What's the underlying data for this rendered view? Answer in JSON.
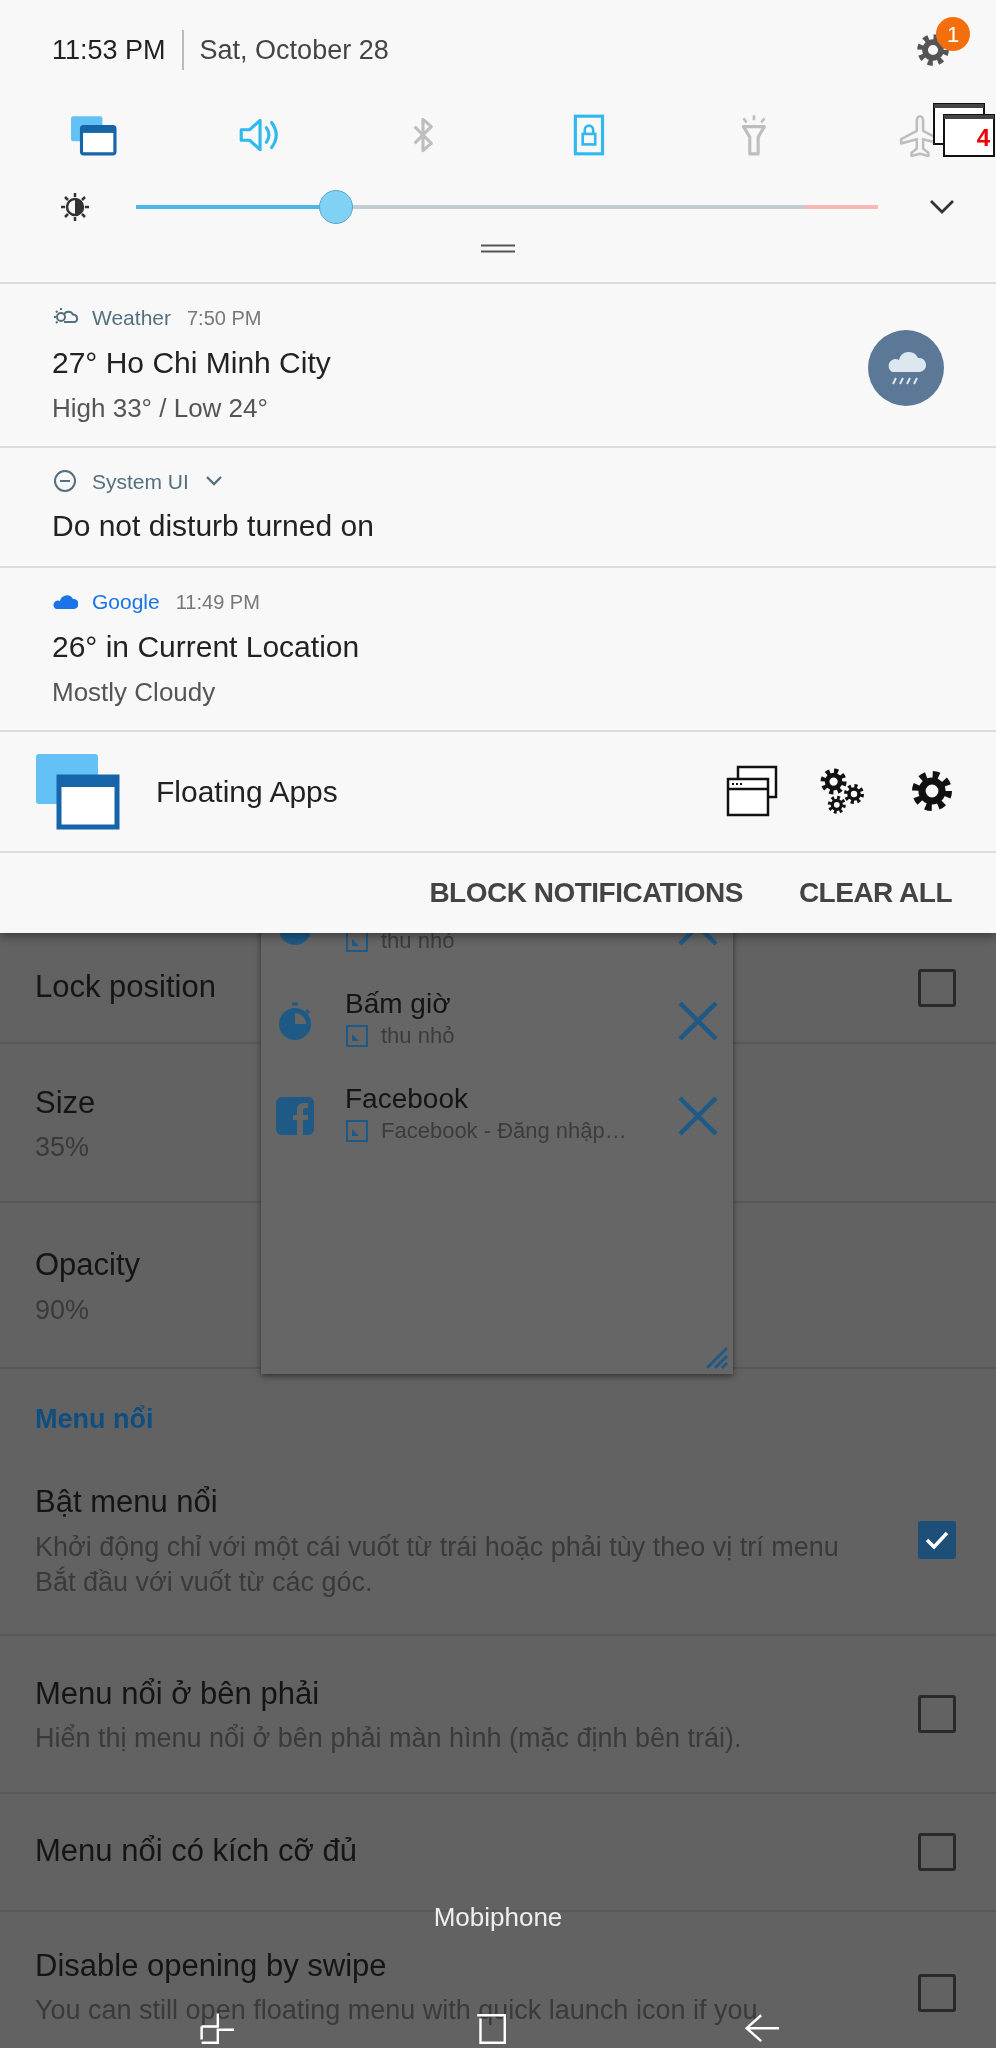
{
  "status_header": {
    "time": "11:53 PM",
    "date": "Sat, October 28",
    "settings_badge": "1"
  },
  "quick_tiles": [
    {
      "kind": "windows",
      "on": true
    },
    {
      "kind": "sound",
      "on": true
    },
    {
      "kind": "bluetooth",
      "on": false
    },
    {
      "kind": "lock",
      "on": true
    },
    {
      "kind": "flashlight",
      "on": false
    },
    {
      "kind": "airplane",
      "on": false
    }
  ],
  "floating_bubble": {
    "count": "4"
  },
  "brightness": {
    "level": 0.27
  },
  "notifications": [
    {
      "kind": "weather",
      "app": "Weather",
      "color": "#54707f",
      "time": "7:50 PM",
      "title": "27° Ho Chi Minh City",
      "text": "High 33° / Low 24°"
    },
    {
      "kind": "dnd",
      "app": "System UI",
      "color": "#54707f",
      "title": "Do not disturb turned on"
    },
    {
      "kind": "cloud",
      "app": "Google",
      "color": "#1a73e8",
      "time": "11:49 PM",
      "title": "26° in Current Location",
      "text": "Mostly Cloudy"
    }
  ],
  "persistent": {
    "title": "Floating Apps"
  },
  "actions": [
    "BLOCK NOTIFICATIONS",
    "CLEAR ALL"
  ],
  "settings": [
    {
      "kind": "toggle",
      "title": "Lock position",
      "checked": false
    },
    {
      "kind": "value",
      "title": "Size",
      "value": "35%"
    },
    {
      "kind": "value",
      "title": "Opacity",
      "value": "90%"
    },
    {
      "kind": "header",
      "title": "Menu nổi"
    },
    {
      "kind": "toggle",
      "title": "Bật menu nổi",
      "text": "Khởi động chỉ với một cái vuốt từ trái hoặc phải tùy theo vị trí menu Bắt đầu với vuốt từ các góc.",
      "checked": true
    },
    {
      "kind": "toggle",
      "title": "Menu nổi ở bên phải",
      "text": "Hiển thị menu nổi ở bên phải màn hình (mặc định bên trái).",
      "checked": false
    },
    {
      "kind": "toggle",
      "title": "Menu nổi có kích cỡ đủ",
      "checked": false
    },
    {
      "kind": "toggle",
      "title": "Disable opening by swipe",
      "text": "You can still open floating menu with quick launch icon if you",
      "checked": false
    }
  ],
  "floating_window": {
    "items": [
      {
        "kind": "clock",
        "subtitle": "thu nhỏ"
      },
      {
        "kind": "clock",
        "title": "Bấm giờ",
        "subtitle": "thu nhỏ"
      },
      {
        "kind": "facebook",
        "title": "Facebook",
        "subtitle": "Facebook - Đăng nhập…"
      }
    ]
  },
  "nav_bar": {
    "carrier": "Mobiphone"
  }
}
